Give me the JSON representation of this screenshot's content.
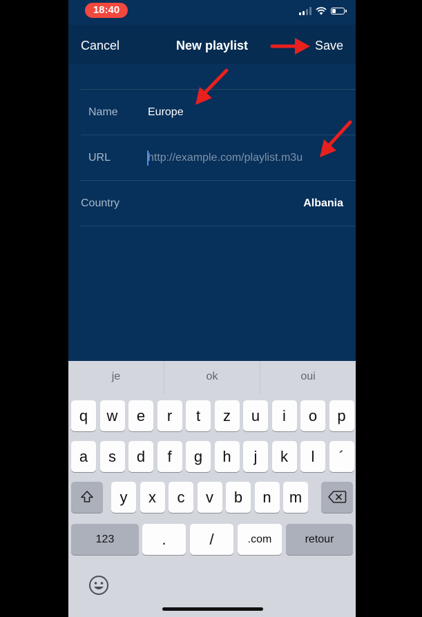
{
  "status_bar": {
    "time": "18:40",
    "battery_level": 0.35
  },
  "nav": {
    "cancel_label": "Cancel",
    "title": "New playlist",
    "save_label": "Save"
  },
  "form": {
    "name": {
      "label": "Name",
      "value": "Europe"
    },
    "url": {
      "label": "URL",
      "value": "",
      "placeholder": "http://example.com/playlist.m3u"
    },
    "country": {
      "label": "Country",
      "value": "Albania"
    }
  },
  "keyboard": {
    "suggestions": [
      "je",
      "ok",
      "oui"
    ],
    "row1": [
      "q",
      "w",
      "e",
      "r",
      "t",
      "z",
      "u",
      "i",
      "o",
      "p"
    ],
    "row2": [
      "a",
      "s",
      "d",
      "f",
      "g",
      "h",
      "j",
      "k",
      "l",
      "´"
    ],
    "row3": [
      "y",
      "x",
      "c",
      "v",
      "b",
      "n",
      "m"
    ],
    "shift_icon": "shift-icon",
    "delete_icon": "delete-icon",
    "numbers_label": "123",
    "period_label": ".",
    "slash_label": "/",
    "dotcom_label": ".com",
    "return_label": "retour",
    "emoji_icon": "emoji-icon"
  },
  "colors": {
    "background": "#07305a",
    "nav_background": "#072c52",
    "time_pill": "#f2483e",
    "annotation_arrow": "#e8201e",
    "keyboard": "#d3d6dd"
  }
}
